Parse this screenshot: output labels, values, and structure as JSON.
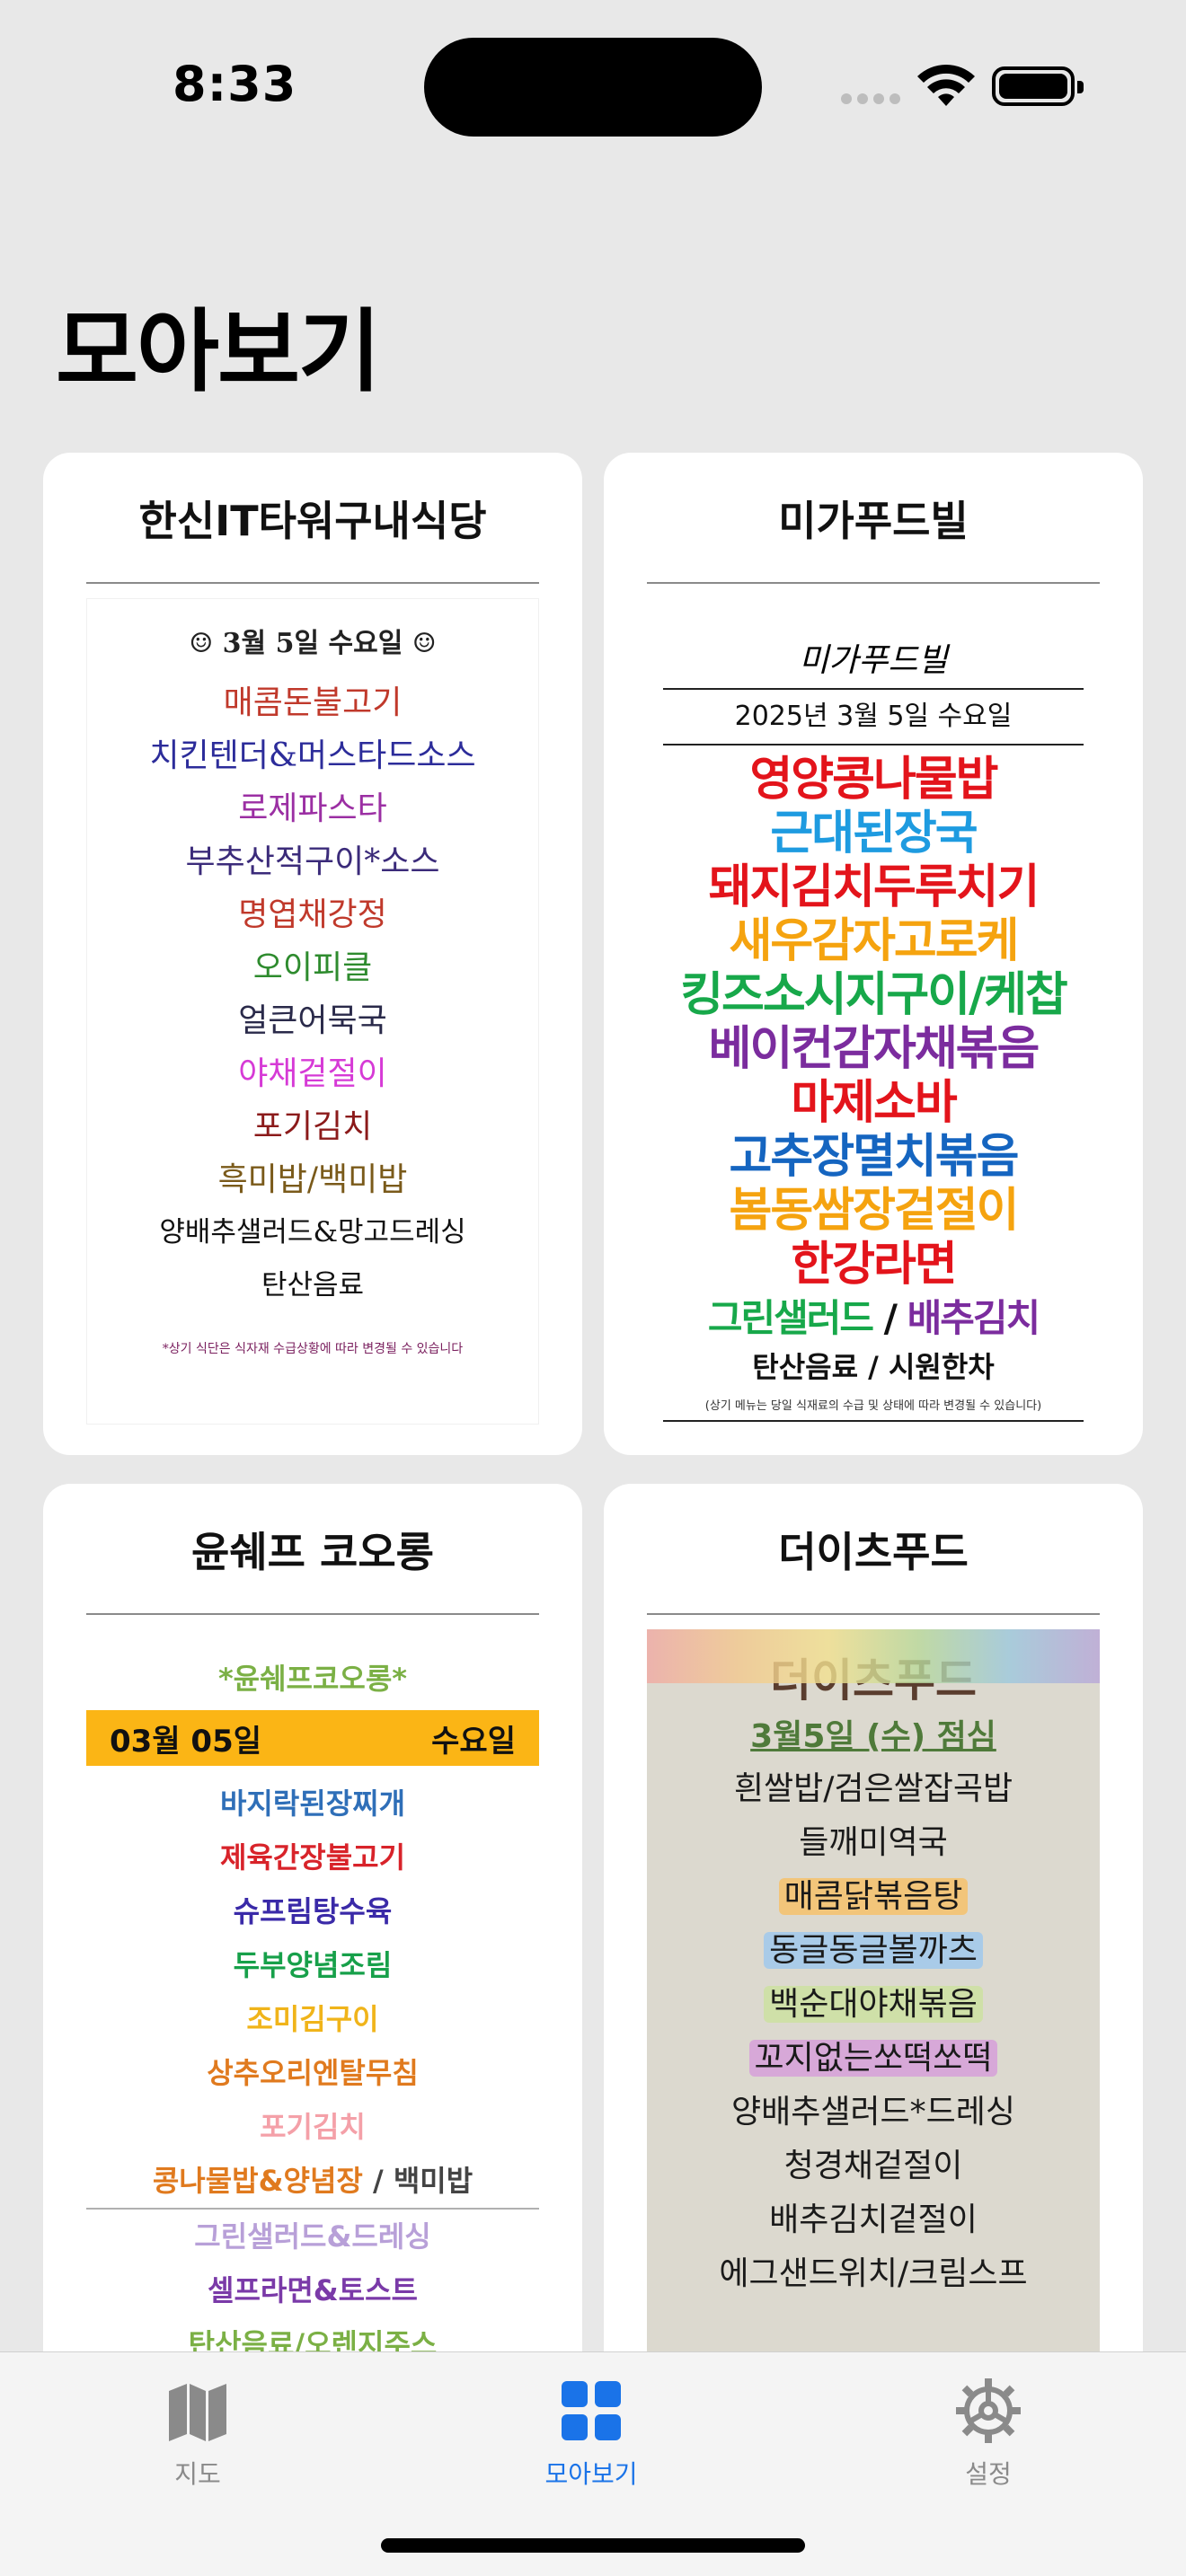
{
  "status_bar": {
    "time": "8:33",
    "wifi_icon": "wifi-icon",
    "battery_icon": "battery-icon"
  },
  "page_title": "모아보기",
  "cards": [
    {
      "title": "한신IT타워구내식당",
      "menu": {
        "date": "☺ 3월  5일   수요일 ☺",
        "items": [
          {
            "text": "매콤돈불고기",
            "color": "#c0392b"
          },
          {
            "text": "치킨텐더&머스타드소스",
            "color": "#2c2c9a"
          },
          {
            "text": "로제파스타",
            "color": "#9b2fa3"
          },
          {
            "text": "부추산적구이*소스",
            "color": "#3b2b7a"
          },
          {
            "text": "명엽채강정",
            "color": "#c0392b"
          },
          {
            "text": "오이피클",
            "color": "#2e8b2e"
          },
          {
            "text": "얼큰어묵국",
            "color": "#2a2a4a"
          },
          {
            "text": "야채겉절이",
            "color": "#d63ad6"
          },
          {
            "text": "포기김치",
            "color": "#8b1a1a"
          },
          {
            "text": "흑미밥/백미밥",
            "color": "#7a5a1a"
          },
          {
            "text": "양배추샐러드&망고드레싱",
            "color": "#111111"
          },
          {
            "text": "탄산음료",
            "color": "#111111"
          }
        ],
        "note": "*상기 식단은 식자재 수급상황에 따라 변경될 수 있습니다"
      }
    },
    {
      "title": "미가푸드빌",
      "menu": {
        "logo": "미가푸드빌",
        "date": "2025년 3월 5일 수요일",
        "items": [
          {
            "text": "영양콩나물밥",
            "color": "#e3141b"
          },
          {
            "text": "근대된장국",
            "color": "#1e9be0"
          },
          {
            "text": "돼지김치두루치기",
            "color": "#e3141b"
          },
          {
            "text": "새우감자고로케",
            "color": "#f5a30f"
          },
          {
            "text": "킹즈소시지구이/케찹",
            "color": "#17a84a"
          },
          {
            "text": "베이컨감자채볶음",
            "color": "#7b2c9e"
          },
          {
            "text": "마제소바",
            "color": "#e3141b"
          },
          {
            "text": "고추장멸치볶음",
            "color": "#1565c0"
          },
          {
            "text": "봄동쌈장겉절이",
            "color": "#f5a30f"
          },
          {
            "text": "한강라면",
            "color": "#e3141b"
          }
        ],
        "salad_left": "그린샐러드",
        "salad_sep": " / ",
        "salad_right": "배추김치",
        "drinks": "탄산음료 / 시원한차",
        "note": "(상기 메뉴는 당일 식재료의 수급 및 상태에 따라 변경될 수 있습니다)"
      }
    },
    {
      "title": "윤쉐프 코오롱",
      "menu": {
        "brand": "*윤쉐프코오롱*",
        "date_left": "03월 05일",
        "date_right": "수요일",
        "items": [
          {
            "text": "바지락된장찌개",
            "color": "#2f6fb8"
          },
          {
            "text": "제육간장불고기",
            "color": "#d8232a"
          },
          {
            "text": "슈프림탕수육",
            "color": "#3a2aa8"
          },
          {
            "text": "두부양념조림",
            "color": "#17a04a"
          },
          {
            "text": "조미김구이",
            "color": "#f0b41a"
          },
          {
            "text": "상추오리엔탈무침",
            "color": "#e07a1e"
          },
          {
            "text": "포기김치",
            "color": "#f4a0a8"
          }
        ],
        "rice_left": "콩나물밥&양념장",
        "rice_sep": " / ",
        "rice_right": "백미밥",
        "items2": [
          {
            "text": "그린샐러드&드레싱",
            "color": "#b8a0d8"
          },
          {
            "text": "셀프라면&토스트",
            "color": "#7a3aa8"
          },
          {
            "text": "탄산음료/오렌지주스",
            "color": "#7bb045"
          }
        ]
      }
    },
    {
      "title": "더이츠푸드",
      "menu": {
        "brand": "더이츠푸드",
        "date": "3월5일 (수) 점심",
        "items": [
          {
            "text": "흰쌀밥/검은쌀잡곡밥",
            "highlight": ""
          },
          {
            "text": "들깨미역국",
            "highlight": ""
          },
          {
            "text": "매콤닭볶음탕",
            "highlight": "#f2c57a"
          },
          {
            "text": "동글동글볼까츠",
            "highlight": "#a9cbe8"
          },
          {
            "text": "백순대야채볶음",
            "highlight": "#cfe0a8"
          },
          {
            "text": "꼬지없는쏘떡쏘떡",
            "highlight": "#d7a8d8"
          },
          {
            "text": "양배추샐러드*드레싱",
            "highlight": ""
          },
          {
            "text": "청경채겉절이",
            "highlight": ""
          },
          {
            "text": "배추김치겉절이",
            "highlight": ""
          },
          {
            "text": "에그샌드위치/크림스프",
            "highlight": ""
          }
        ]
      }
    }
  ],
  "tabs": [
    {
      "label": "지도",
      "icon": "map-icon",
      "active": false
    },
    {
      "label": "모아보기",
      "icon": "grid-icon",
      "active": true
    },
    {
      "label": "설정",
      "icon": "gear-icon",
      "active": false
    }
  ],
  "colors": {
    "accent": "#1a73e8",
    "inactive": "#8a8a8a",
    "background": "#e8e8e8"
  }
}
